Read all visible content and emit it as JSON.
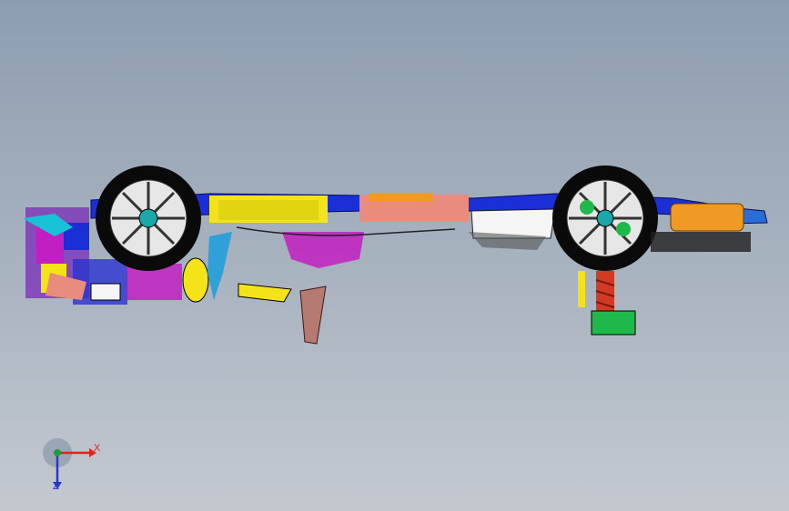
{
  "viewport": {
    "background_top": "#8d9db0",
    "background_bottom": "#c4c9d0"
  },
  "model": {
    "description_icon": "vehicle-chassis-assembly-icon",
    "colors": {
      "tire": "#0a0a0a",
      "rim": "#e6e6e6",
      "frame_blue": "#1b2fd6",
      "yellow": "#f3e318",
      "salmon": "#e98c7e",
      "orange": "#ef9a24",
      "magenta": "#c21fc2",
      "green": "#1fb84a",
      "red": "#d23a22",
      "white": "#f5f5f5"
    }
  },
  "triad": {
    "x_label": "X",
    "z_label": "Z",
    "x_color": "#e0231b",
    "y_color": "#1aa23a",
    "z_color": "#2b33d1"
  }
}
